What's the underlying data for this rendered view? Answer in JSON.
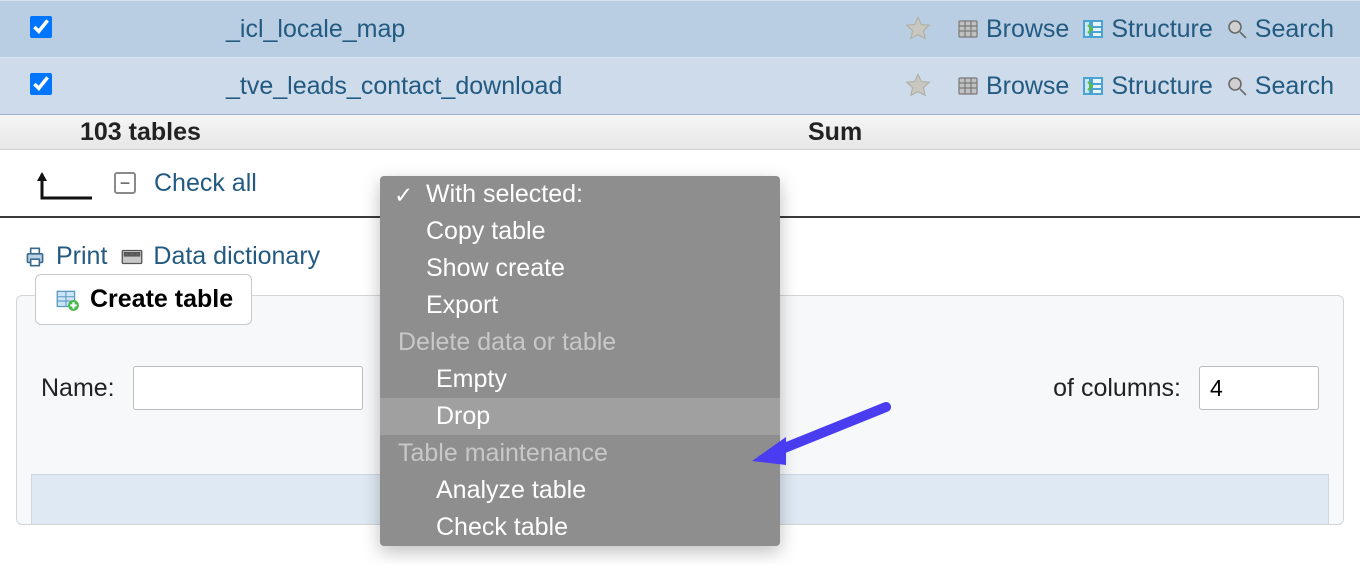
{
  "rows": [
    {
      "name": "_icl_locale_map",
      "checked": true
    },
    {
      "name": "_tve_leads_contact_download",
      "checked": true
    }
  ],
  "action_labels": {
    "browse": "Browse",
    "structure": "Structure",
    "search": "Search"
  },
  "summary": {
    "count": "103 tables",
    "sum": "Sum"
  },
  "checkall": {
    "label": "Check all"
  },
  "tools": {
    "print": "Print",
    "data_dictionary": "Data dictionary"
  },
  "create": {
    "button": "Create table",
    "name_label": "Name:",
    "name_value": "",
    "cols_label": "of columns:",
    "cols_value": "4"
  },
  "dropdown": {
    "selected": "With selected:",
    "copy": "Copy table",
    "show_create": "Show create",
    "export": "Export",
    "grp_delete": "Delete data or table",
    "empty": "Empty",
    "drop": "Drop",
    "grp_maint": "Table maintenance",
    "analyze": "Analyze table",
    "check": "Check table"
  }
}
